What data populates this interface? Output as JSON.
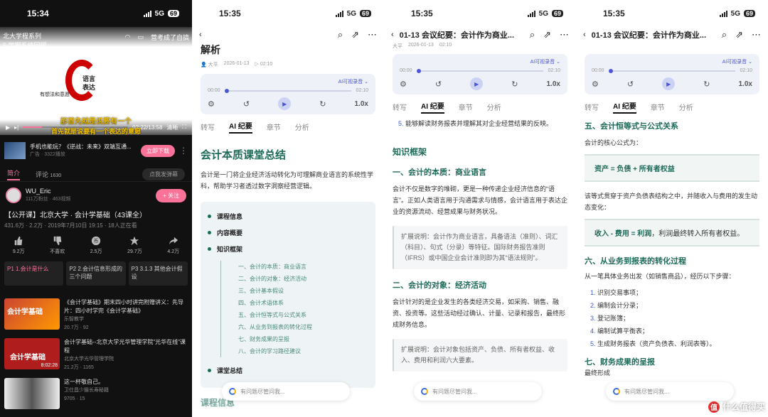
{
  "status": {
    "time": "15:35",
    "time_p1": "15:34",
    "network": "5G",
    "battery": "69"
  },
  "p1": {
    "video_overlay_left": "北大学程系列",
    "video_overlay_sub": "5 学期系统回顾",
    "video_overlay_right": "营考成了自搞",
    "center_text_1": "语言",
    "center_text_2": "表达",
    "side_text": "有想法和意愿",
    "subtitle_1": "那首先就是说要有一个",
    "subtitle_2": "首先就是说要有一个表达的意愿",
    "time": "02:22/13:58",
    "quality": "清晰",
    "ad_title": "手机也能玩？《逆战：未来》双端互通...",
    "ad_sub": "广告 · 3322播放",
    "ad_button": "立即下载",
    "tab_intro": "简介",
    "tab_comments": "评论",
    "comment_count": "1630",
    "danmu_placeholder": "点我发弹幕",
    "uploader": "WU_Eric",
    "uploader_stats": "111万粉丝 · 463视频",
    "follow": "+ 关注",
    "video_title": "【公开课】北京大学 · 会计学基础（43课全）",
    "video_meta": "431.6万 · 2.2万 · 2019年7月10日 19:15 · 18人正在看",
    "actions": [
      {
        "icon": "thumb-up-icon",
        "label": "9.2万"
      },
      {
        "icon": "thumb-down-icon",
        "label": "不喜欢"
      },
      {
        "icon": "coin-icon",
        "label": "2.5万"
      },
      {
        "icon": "star-icon",
        "label": "29.7万"
      },
      {
        "icon": "share-icon",
        "label": "4.2万"
      }
    ],
    "chapters": [
      "P1 1.会计是什么",
      "P2 2.会计信息形成的三个问题",
      "P3 3.1.3 其他会计假设"
    ],
    "recs": [
      {
        "title": "《会计学基础》期末四小时讲完附赠讲义：先导片：四小时学完《会计学基础》",
        "author": "乐智教学",
        "stats": "20.7万 · 92",
        "thumb": "会计学基础"
      },
      {
        "title": "会计学基础--北京大学光华管理学院\"光华在线\"课程",
        "author": "北京大学光华管理学院",
        "stats": "21.2万 · 1165",
        "thumb": "会计学基础",
        "duration": "8:02:28"
      },
      {
        "title": "这一杯敬自己。",
        "author": "卫仕昌少猫长寿秘籍",
        "stats": "9705 · 15",
        "thumb": ""
      }
    ]
  },
  "p2": {
    "heading_partial": "解析",
    "author": "大平",
    "date": "2026-01-13",
    "duration": "02:10",
    "ai_button": "AI可视录音",
    "t_start": "00:00",
    "t_end": "02:10",
    "speed": "1.0x",
    "tabs": [
      "转写",
      "AI 纪要",
      "章节",
      "分析"
    ],
    "title": "会计本质课堂总结",
    "intro": "会计是一门将企业经济活动转化为可理解商业语言的系统性学科，帮助学习者透过数字洞察经营逻辑。",
    "toc": [
      "课程信息",
      "内容概要",
      "知识框架"
    ],
    "toc_sub": [
      "一、会计的本质：商业语言",
      "二、会计的对象：经济活动",
      "三、会计基本假设",
      "四、会计术语体系",
      "五、会计恒等式与公式关系",
      "六、从业务到报表的转化过程",
      "七、财务成果的呈报",
      "八、会计的学习路径建议"
    ],
    "toc_last": "课堂总结",
    "cut_text": "课程信息",
    "ask": "有问题尽管问我..."
  },
  "p3": {
    "nav_title": "01-13 会议纪要：会计作为商业...",
    "author": "大平",
    "date": "2026-01-13",
    "duration": "02:10",
    "list_5": "能够解读财务报表并理解其对企业经营结果的反映。",
    "framework": "知识框架",
    "sec1_title": "一、会计的本质：商业语言",
    "sec1_body": "会计不仅是数字的堆砌，更是一种传递企业经济信息的“语言”。正如人类语言用于沟通需求与情感，会计语言用于表达企业的资源流动、经营成果与财务状况。",
    "sec1_note": "扩展说明：会计作为商业语言，具备语法（准则）、词汇（科目）、句式（分录）等特征。国际财务报告准则（IFRS）或中国企业会计准则即为其“语法规则”。",
    "sec2_title": "二、会计的对象：经济活动",
    "sec2_body": "会计针对的是企业发生的各类经济交易，如采购、销售、融资、投资等。这些活动经过确认、计量、记录和报告，最终形成财务信息。",
    "sec2_note": "扩展说明：会计对象包括资产、负债、所有者权益、收入、费用和利润六大要素。"
  },
  "p4": {
    "nav_title": "01-13 会议纪要：会计作为商业...",
    "sec5_title": "五、会计恒等式与公式关系",
    "sec5_intro": "会计的核心公式为：",
    "formula1": "资产 = 负债 + 所有者权益",
    "formula1_text": "该等式贯穿于资产负债表结构之中，并随收入与费用的发生动态变化：",
    "formula2_bold": "收入 - 费用 = 利润",
    "formula2_rest": "，利润最终转入所有者权益。",
    "sec6_title": "六、从业务到报表的转化过程",
    "sec6_intro": "从一笔具体业务出发（如销售商品），经历以下步骤：",
    "steps": [
      "识别交易事项；",
      "编制会计分录；",
      "登记账簿；",
      "编制试算平衡表；",
      "生成财务报表（资产负债表、利润表等）。"
    ],
    "sec7_title": "七、财务成果的呈报",
    "sec7_cut": "最终形成",
    "watermark": "什么值得买"
  }
}
